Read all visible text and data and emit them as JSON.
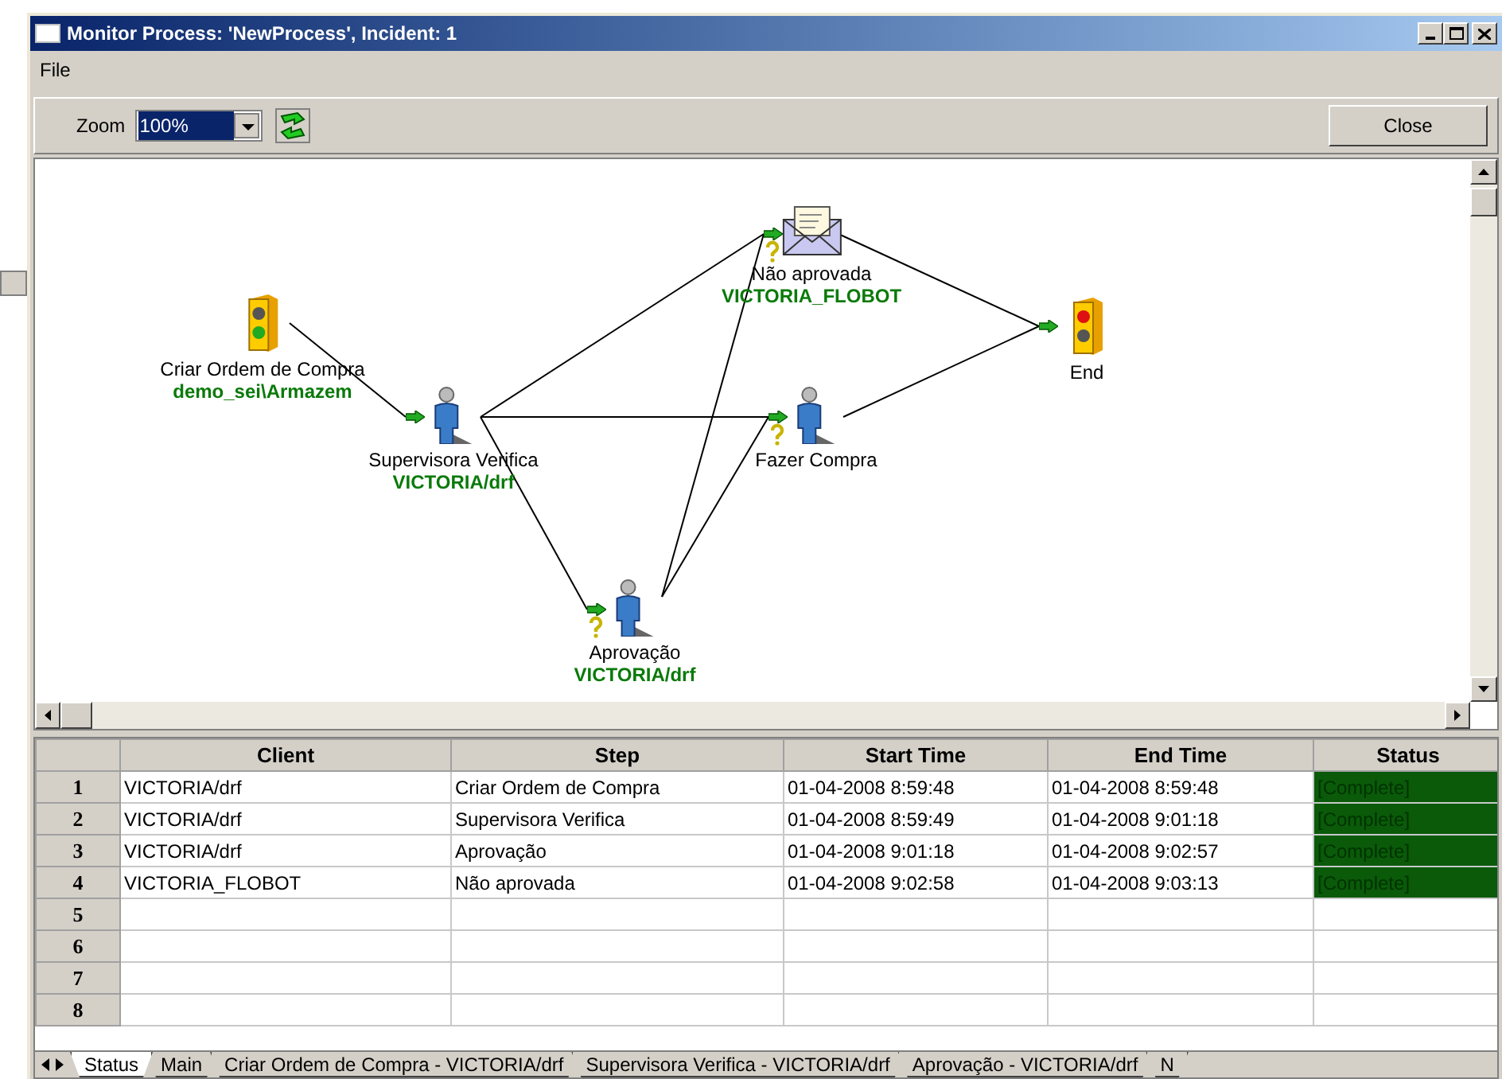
{
  "window": {
    "title": "Monitor Process: 'NewProcess', Incident: 1"
  },
  "menu": [
    "File"
  ],
  "toolbar": {
    "zoom_label": "Zoom",
    "zoom_value": "100%",
    "close": "Close"
  },
  "diagram": {
    "nodes": [
      {
        "kind": "start",
        "label": "Criar Ordem de Compra",
        "user": "demo_sei\\Armazem",
        "conditional": false
      },
      {
        "kind": "person",
        "label": "Supervisora Verifica",
        "user": "VICTORIA/drf",
        "conditional": false
      },
      {
        "kind": "email",
        "label": "Não aprovada",
        "user": "VICTORIA_FLOBOT",
        "conditional": true
      },
      {
        "kind": "person",
        "label": "Fazer Compra",
        "conditional": true
      },
      {
        "kind": "person",
        "label": "Aprovação",
        "user": "VICTORIA/drf",
        "conditional": true
      },
      {
        "kind": "end",
        "label": "End",
        "conditional": false
      }
    ]
  },
  "grid": {
    "columns": [
      "Client",
      "Step",
      "Start Time",
      "End Time",
      "Status"
    ],
    "rows": [
      {
        "number": "1",
        "cells": [
          "VICTORIA/drf",
          "Criar Ordem de Compra",
          "01-04-2008 8:59:48",
          "01-04-2008 8:59:48",
          "[Complete]"
        ]
      },
      {
        "number": "2",
        "cells": [
          "VICTORIA/drf",
          "Supervisora Verifica",
          "01-04-2008 8:59:49",
          "01-04-2008 9:01:18",
          "[Complete]"
        ]
      },
      {
        "number": "3",
        "cells": [
          "VICTORIA/drf",
          "Aprovação",
          "01-04-2008 9:01:18",
          "01-04-2008 9:02:57",
          "[Complete]"
        ]
      },
      {
        "number": "4",
        "cells": [
          "VICTORIA_FLOBOT",
          "Não aprovada",
          "01-04-2008 9:02:58",
          "01-04-2008 9:03:13",
          "[Complete]"
        ]
      },
      {
        "number": "5",
        "cells": []
      },
      {
        "number": "6",
        "cells": []
      },
      {
        "number": "7",
        "cells": []
      },
      {
        "number": "8",
        "cells": []
      }
    ]
  },
  "sheet_tabs": [
    {
      "label": "Status",
      "selected": true
    },
    {
      "label": "Main",
      "selected": false
    },
    {
      "label": "Criar Ordem de Compra - VICTORIA/drf",
      "selected": false
    },
    {
      "label": "Supervisora Verifica - VICTORIA/drf",
      "selected": false
    },
    {
      "label": "Aprovação - VICTORIA/drf",
      "selected": false
    },
    {
      "label": "N",
      "selected": false
    }
  ]
}
